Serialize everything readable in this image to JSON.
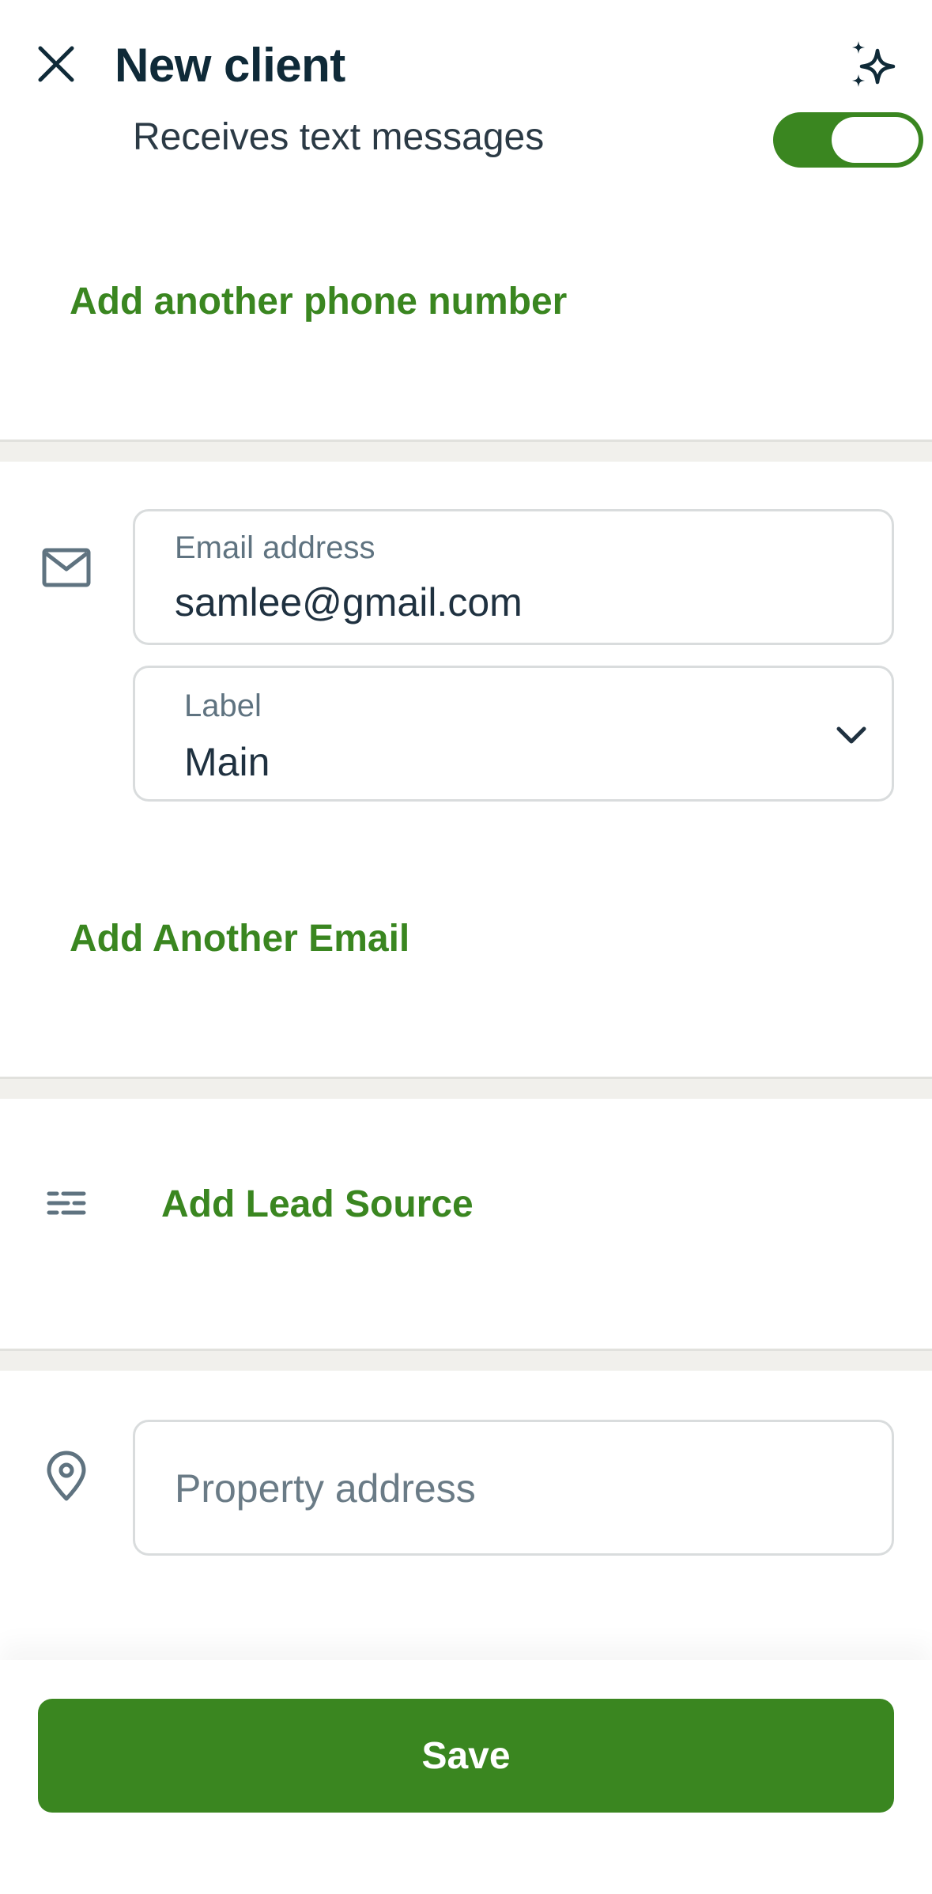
{
  "header": {
    "title": "New client",
    "close_icon": "close-icon",
    "sparkle_icon": "sparkle-icon"
  },
  "phone": {
    "sms_label": "Receives text messages",
    "sms_enabled": true,
    "add_phone_label": "Add another phone number"
  },
  "email": {
    "icon": "mail-icon",
    "field_label": "Email address",
    "value": "samlee@gmail.com",
    "label_field_label": "Label",
    "label_value": "Main",
    "add_email_label": "Add Another Email"
  },
  "lead_source": {
    "icon": "list-icon",
    "add_label": "Add Lead Source"
  },
  "property": {
    "icon": "location-pin-icon",
    "placeholder": "Property address"
  },
  "footer": {
    "save_label": "Save"
  },
  "colors": {
    "accent": "#3a8620",
    "title": "#0f2a38",
    "divider": "#f1f0ec"
  }
}
